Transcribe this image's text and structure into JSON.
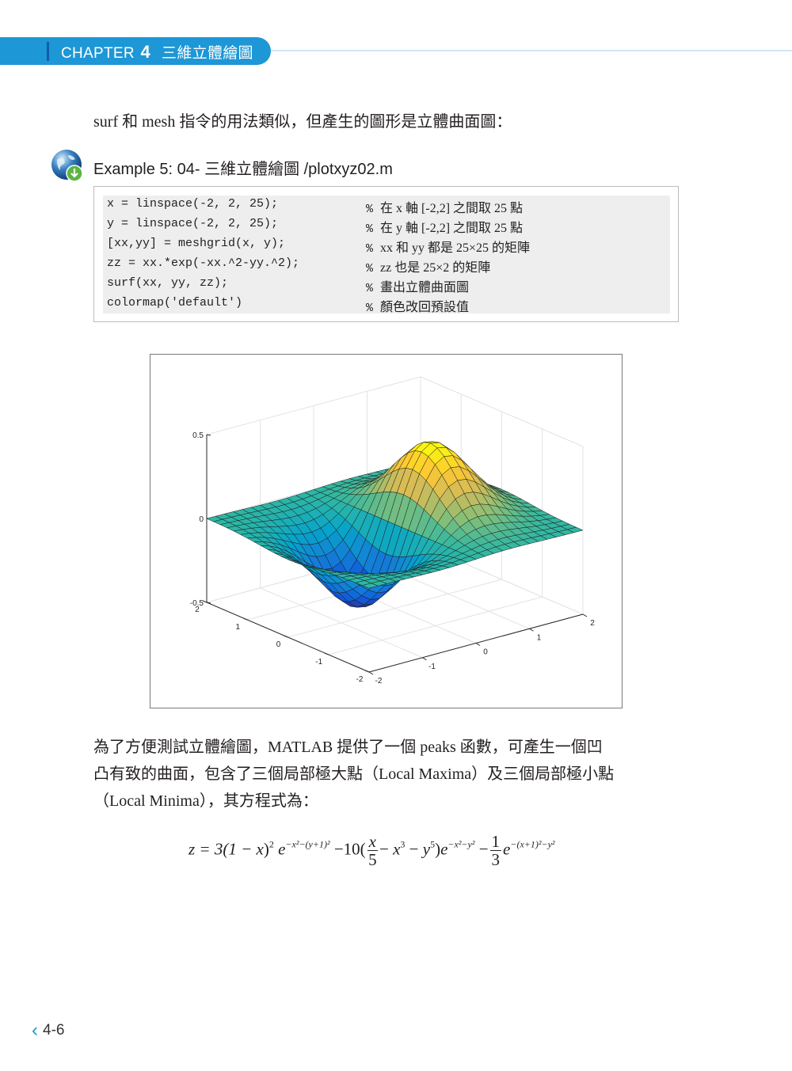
{
  "header": {
    "chapter_label": "CHAPTER",
    "chapter_number": "4",
    "chapter_title": "三維立體繪圖",
    "accent_color": "#1d97d6"
  },
  "intro": "surf 和 mesh 指令的用法類似，但產生的圖形是立體曲面圖：",
  "example": {
    "icon": "globe-download-icon",
    "title": "Example 5: 04- 三維立體繪圖 /plotxyz02.m"
  },
  "code": [
    {
      "code": "x = linspace(-2, 2, 25);",
      "comment_mark": "%",
      "comment": "在 x 軸 [-2,2] 之間取 25 點"
    },
    {
      "code": "y = linspace(-2, 2, 25);",
      "comment_mark": "%",
      "comment": "在 y 軸 [-2,2] 之間取 25 點"
    },
    {
      "code": "[xx,yy] = meshgrid(x, y);",
      "comment_mark": "%",
      "comment": "xx 和 yy 都是 25×25 的矩陣"
    },
    {
      "code": "zz = xx.*exp(-xx.^2-yy.^2);",
      "comment_mark": "%",
      "comment": "zz 也是 25×2 的矩陣"
    },
    {
      "code": "surf(xx, yy, zz);",
      "comment_mark": "%",
      "comment": "畫出立體曲面圖"
    },
    {
      "code": "colormap('default')",
      "comment_mark": "%",
      "comment": "顏色改回預設值"
    }
  ],
  "chart_data": {
    "type": "surface",
    "function": "z = x*exp(-x^2-y^2)",
    "grid_points": 25,
    "xlim": [
      -2,
      2
    ],
    "ylim": [
      -2,
      2
    ],
    "zlim": [
      -0.5,
      0.5
    ],
    "x_ticks": [
      "-2",
      "-1",
      "0",
      "1",
      "2"
    ],
    "y_ticks": [
      "-2",
      "-1",
      "0",
      "1",
      "2"
    ],
    "z_ticks": [
      "-0.5",
      "0",
      "0.5"
    ],
    "colormap": "parula",
    "grid": true
  },
  "paragraph": [
    "為了方便測試立體繪圖，MATLAB 提供了一個 peaks 函數，可產生一個凹",
    "凸有致的曲面，包含了三個局部極大點（Local Maxima）及三個局部極小點",
    "（Local Minima），其方程式為："
  ],
  "formula": {
    "a": "z = 3(1 − ",
    "a_x": "x",
    "a2": ")",
    "sup1": "2",
    "e1": "e",
    "sup_e1": "−x²−(y+1)²",
    "b": " −10(",
    "frac1_n": "x",
    "frac1_d": "5",
    "b2": "− ",
    "b_x": "x",
    "sup3": "3",
    "b3": " − ",
    "b_y": "y",
    "sup5": "5",
    "b4": ")",
    "e2": "e",
    "sup_e2": "−x²−y²",
    "c": " −",
    "frac2_n": "1",
    "frac2_d": "3",
    "e3": "e",
    "sup_e3": "−(x+1)²−y²"
  },
  "footer": {
    "page_number": "4-6"
  }
}
